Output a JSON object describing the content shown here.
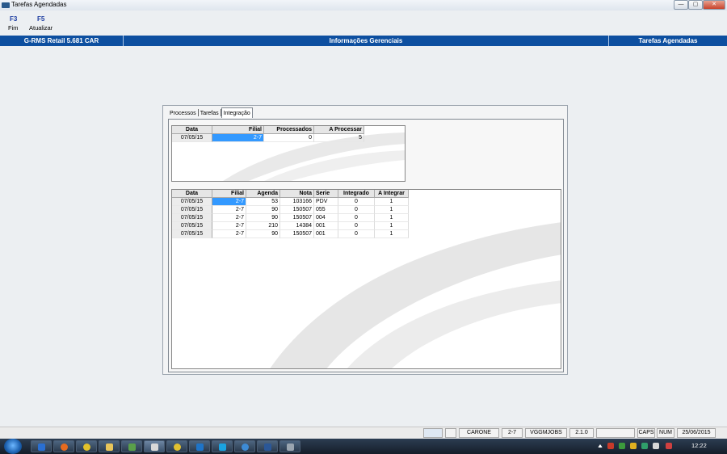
{
  "window": {
    "title": "Tarefas Agendadas",
    "minimize": "—",
    "maximize": "▢",
    "close": "✕"
  },
  "toolbar": [
    {
      "key": "F3",
      "label": "Fim"
    },
    {
      "key": "F5",
      "label": "Atualizar"
    }
  ],
  "header": {
    "left": "G-RMS Retail 5.681 CAR",
    "center": "Informações Gerenciais",
    "right": "Tarefas Agendadas"
  },
  "tabs": [
    {
      "label": "Processos"
    },
    {
      "label": "Tarefas"
    },
    {
      "label": "Integração",
      "active": true
    }
  ],
  "summary_grid": {
    "columns": [
      "Data",
      "Filial",
      "Processados",
      "A Processar"
    ],
    "rows": [
      [
        "07/05/15",
        "2-7",
        "0",
        "5"
      ]
    ]
  },
  "detail_grid": {
    "columns": [
      "Data",
      "Filial",
      "Agenda",
      "Nota",
      "Serie",
      "Integrado",
      "A Integrar"
    ],
    "rows": [
      [
        "07/05/15",
        "2-7",
        "53",
        "103166",
        "PDV",
        "0",
        "1"
      ],
      [
        "07/05/15",
        "2-7",
        "90",
        "150507",
        "055",
        "0",
        "1"
      ],
      [
        "07/05/15",
        "2-7",
        "90",
        "150507",
        "004",
        "0",
        "1"
      ],
      [
        "07/05/15",
        "2-7",
        "210",
        "14384",
        "001",
        "0",
        "1"
      ],
      [
        "07/05/15",
        "2-7",
        "90",
        "150507",
        "001",
        "0",
        "1"
      ]
    ]
  },
  "statusbar": {
    "user": "CARONE",
    "branch": "2-7",
    "job": "VGGMJOBS",
    "version": "2.1.0",
    "caps": "CAPS",
    "num": "NUM",
    "date": "25/06/2015"
  },
  "taskbar": {
    "clock": "12:22"
  },
  "colors": {
    "header": "#0d4fa0",
    "selection": "#3399ff",
    "fkey": "#1a3aa0"
  }
}
